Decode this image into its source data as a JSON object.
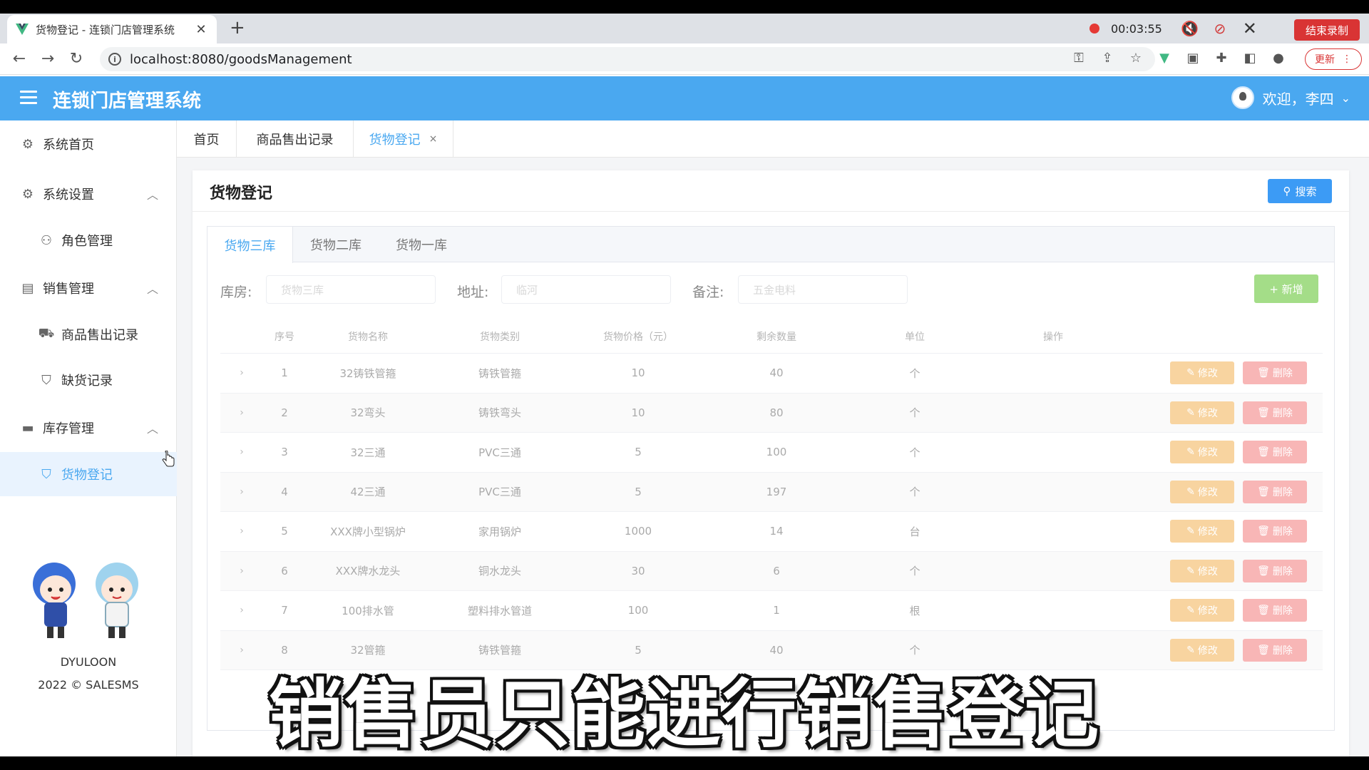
{
  "browser": {
    "tab_title": "货物登记 - 连锁门店管理系统",
    "url": "localhost:8080/goodsManagement",
    "recording_time": "00:03:55",
    "end_recording_label": "结束录制",
    "update_label": "更新"
  },
  "header": {
    "title": "连锁门店管理系统",
    "welcome": "欢迎，李四"
  },
  "sidebar": {
    "items": [
      {
        "label": "系统首页",
        "icon": "gear-outline-icon"
      },
      {
        "label": "系统设置",
        "icon": "gear-icon"
      },
      {
        "label": "角色管理",
        "icon": "user-icon"
      },
      {
        "label": "销售管理",
        "icon": "chart-icon"
      },
      {
        "label": "商品售出记录",
        "icon": "truck-icon"
      },
      {
        "label": "缺货记录",
        "icon": "bag-icon"
      },
      {
        "label": "库存管理",
        "icon": "briefcase-icon"
      },
      {
        "label": "货物登记",
        "icon": "shopping-bag-icon"
      }
    ],
    "brand": "DYULOON",
    "copyright": "2022 © SALESMS"
  },
  "tags": [
    {
      "label": "首页"
    },
    {
      "label": "商品售出记录"
    },
    {
      "label": "货物登记",
      "close": "×"
    }
  ],
  "panel": {
    "title": "货物登记",
    "search_label": "搜索",
    "subtabs": [
      "货物三库",
      "货物二库",
      "货物一库"
    ],
    "filters": {
      "warehouse_label": "库房:",
      "warehouse_value": "货物三库",
      "address_label": "地址:",
      "address_value": "临河",
      "remark_label": "备注:",
      "remark_value": "五金电料",
      "add_label": "+ 新增"
    }
  },
  "table": {
    "columns": [
      "序号",
      "货物名称",
      "货物类别",
      "货物价格（元）",
      "剩余数量",
      "单位",
      "操作"
    ],
    "edit_label": "修改",
    "delete_label": "删除",
    "rows": [
      {
        "no": "1",
        "name": "32铸铁管箍",
        "category": "铸铁管箍",
        "price": "10",
        "qty": "40",
        "unit": "个"
      },
      {
        "no": "2",
        "name": "32弯头",
        "category": "铸铁弯头",
        "price": "10",
        "qty": "80",
        "unit": "个"
      },
      {
        "no": "3",
        "name": "32三通",
        "category": "PVC三通",
        "price": "5",
        "qty": "100",
        "unit": "个"
      },
      {
        "no": "4",
        "name": "42三通",
        "category": "PVC三通",
        "price": "5",
        "qty": "197",
        "unit": "个"
      },
      {
        "no": "5",
        "name": "XXX牌小型锅炉",
        "category": "家用锅炉",
        "price": "1000",
        "qty": "14",
        "unit": "台"
      },
      {
        "no": "6",
        "name": "XXX牌水龙头",
        "category": "铜水龙头",
        "price": "30",
        "qty": "6",
        "unit": "个"
      },
      {
        "no": "7",
        "name": "100排水管",
        "category": "塑料排水管道",
        "price": "100",
        "qty": "1",
        "unit": "根"
      },
      {
        "no": "8",
        "name": "32管箍",
        "category": "铸铁管箍",
        "price": "5",
        "qty": "40",
        "unit": "个"
      }
    ]
  },
  "caption": "销售员只能进行销售登记",
  "colors": {
    "header_blue": "#4aa8f0",
    "search_blue": "#3c9bf5",
    "add_green": "#a4dd88",
    "edit_orange": "#f8d4a0",
    "delete_red": "#f8b6b6"
  }
}
